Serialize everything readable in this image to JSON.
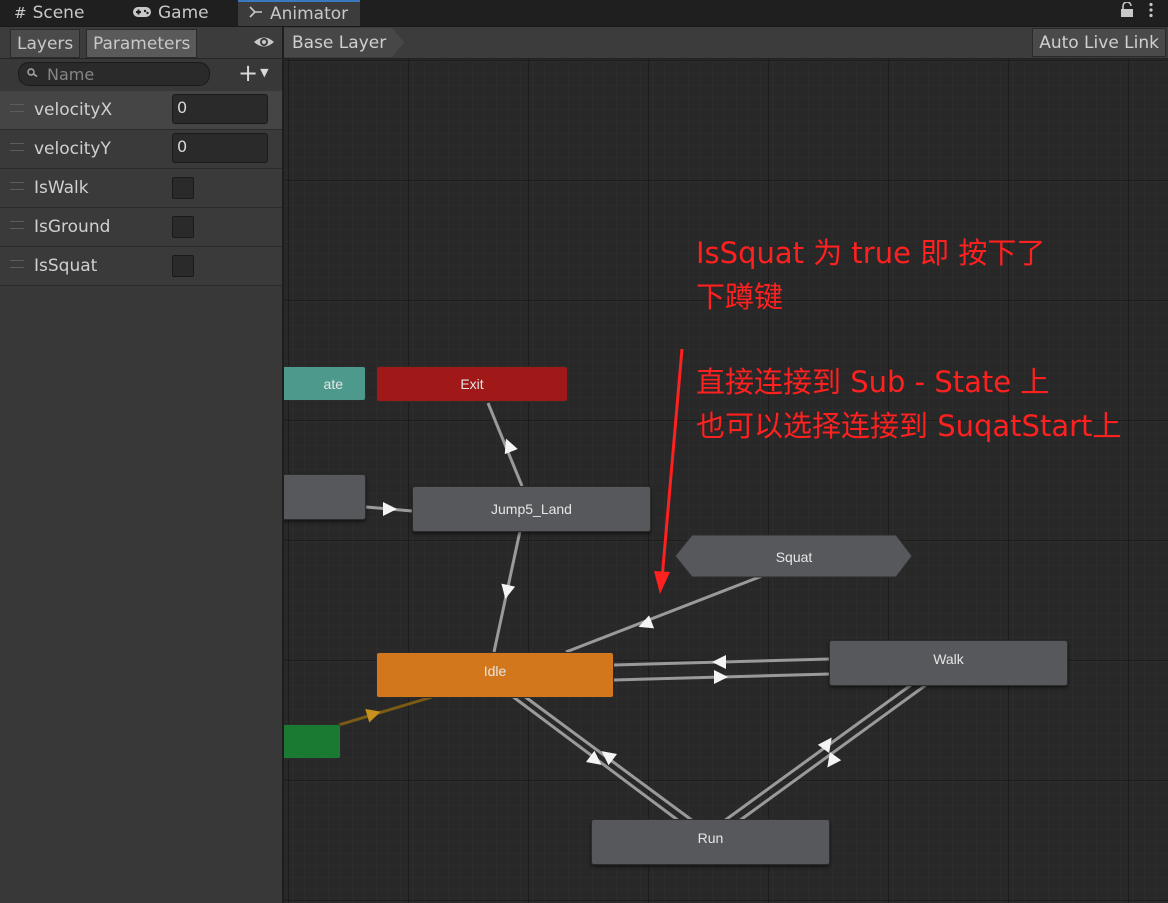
{
  "colors": {
    "accent_tab": "#3a79bb",
    "state_default": "#56585c",
    "state_entry_default": "#d3771c",
    "state_exit": "#a01818",
    "state_entry": "#1b7a32",
    "state_any": "#4d9a8c",
    "annotation": "#ff2020"
  },
  "tabs": [
    {
      "label": "Scene",
      "icon": "grid-icon"
    },
    {
      "label": "Game",
      "icon": "gamepad-icon"
    },
    {
      "label": "Animator",
      "icon": "animator-icon"
    }
  ],
  "window_icons": [
    "lock-icon",
    "kebab-menu-icon"
  ],
  "left_panel": {
    "tabs": {
      "layers": "Layers",
      "parameters": "Parameters"
    },
    "search_placeholder": "Name",
    "add_symbol": "+",
    "parameters": [
      {
        "name": "velocityX",
        "type": "float",
        "value": "0"
      },
      {
        "name": "velocityY",
        "type": "float",
        "value": "0"
      },
      {
        "name": "IsWalk",
        "type": "bool",
        "value": false
      },
      {
        "name": "IsGround",
        "type": "bool",
        "value": false
      },
      {
        "name": "IsSquat",
        "type": "bool",
        "value": false
      }
    ]
  },
  "breadcrumb": {
    "layer": "Base Layer",
    "live_link": "Auto Live Link"
  },
  "graph": {
    "nodes": {
      "any_state": "ate",
      "exit": "Exit",
      "jump_prev": "",
      "jump5_land": "Jump5_Land",
      "squat": "Squat",
      "idle": "Idle",
      "walk": "Walk",
      "entry": "",
      "run": "Run"
    },
    "annotations": [
      "IsSquat 为 true 即 按下了",
      "下蹲键",
      "直接连接到 Sub - State 上",
      "也可以选择连接到 SuqatStart上"
    ]
  }
}
